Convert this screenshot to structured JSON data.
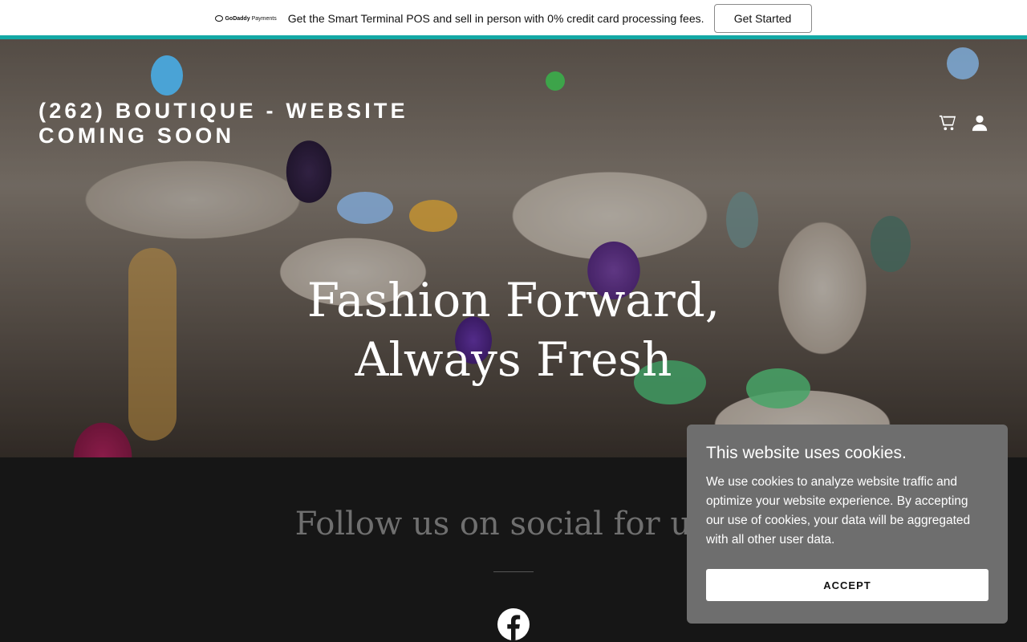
{
  "promo": {
    "logo_brand": "GoDaddy",
    "logo_product": "Payments",
    "message": "Get the Smart Terminal POS and sell in person with 0% credit card processing fees.",
    "cta_label": "Get Started",
    "accent_color": "#13a8a5"
  },
  "header": {
    "site_title": "(262) BOUTIQUE - WEBSITE COMING SOON",
    "icons": [
      "cart-icon",
      "account-icon"
    ]
  },
  "hero": {
    "headline": "Fashion Forward, Always Fresh"
  },
  "social": {
    "heading": "Follow us on social for upd",
    "links": [
      "facebook-icon"
    ]
  },
  "cookie_banner": {
    "title": "This website uses cookies.",
    "body": "We use cookies to analyze website traffic and optimize your website experience. By accepting our use of cookies, your data will be aggregated with all other user data.",
    "accept_label": "ACCEPT"
  }
}
